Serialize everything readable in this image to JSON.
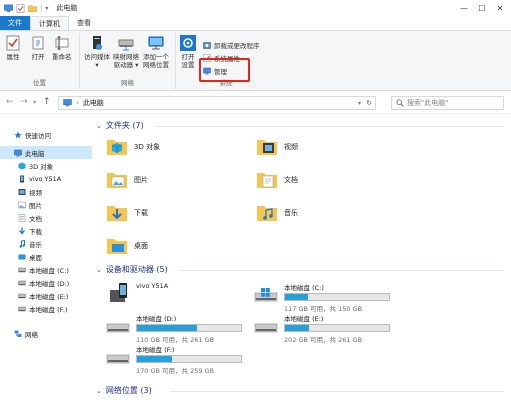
{
  "window": {
    "title": "此电脑",
    "controls": {
      "minimize": "—",
      "maximize": "☐",
      "close": "✕"
    }
  },
  "ribbon_tabs": [
    "文件",
    "计算机",
    "查看"
  ],
  "ribbon": {
    "location_group": {
      "label": "位置",
      "buttons": [
        "属性",
        "打开",
        "重命名"
      ]
    },
    "network_group": {
      "label": "网络",
      "buttons": [
        {
          "line1": "访问媒体",
          "line2": "▾"
        },
        {
          "line1": "映射网络",
          "line2": "驱动器 ▾"
        },
        {
          "line1": "添加一个",
          "line2": "网络位置"
        }
      ]
    },
    "system_group": {
      "label": "系统",
      "open_settings": {
        "line1": "打开",
        "line2": "设置"
      },
      "small_buttons": [
        "卸载或更改程序",
        "系统属性",
        "管理"
      ]
    }
  },
  "address_bar": {
    "breadcrumb": "此电脑",
    "separator": "›",
    "search_placeholder": "搜索\"此电脑\""
  },
  "nav_pane": {
    "items": [
      {
        "label": "快速访问",
        "icon": "star-icon"
      },
      {
        "label": "此电脑",
        "icon": "computer-icon",
        "selected": true
      },
      {
        "label": "3D 对象",
        "icon": "cube-icon"
      },
      {
        "label": "vivo Y51A",
        "icon": "phone-icon"
      },
      {
        "label": "视频",
        "icon": "video-icon"
      },
      {
        "label": "图片",
        "icon": "picture-icon"
      },
      {
        "label": "文档",
        "icon": "document-icon"
      },
      {
        "label": "下载",
        "icon": "download-icon"
      },
      {
        "label": "音乐",
        "icon": "music-icon"
      },
      {
        "label": "桌面",
        "icon": "desktop-icon"
      },
      {
        "label": "本地磁盘 (C:)",
        "icon": "drive-icon"
      },
      {
        "label": "本地磁盘 (D:)",
        "icon": "drive-icon"
      },
      {
        "label": "本地磁盘 (E:)",
        "icon": "drive-icon"
      },
      {
        "label": "本地磁盘 (F:)",
        "icon": "drive-icon"
      },
      {
        "label": "网络",
        "icon": "network-icon"
      }
    ]
  },
  "sections": {
    "folders": {
      "title": "文件夹 (7)",
      "items": [
        {
          "label": "3D 对象",
          "icon": "cube-folder-icon"
        },
        {
          "label": "视频",
          "icon": "video-folder-icon"
        },
        {
          "label": "图片",
          "icon": "picture-folder-icon"
        },
        {
          "label": "文档",
          "icon": "document-folder-icon"
        },
        {
          "label": "下载",
          "icon": "download-folder-icon"
        },
        {
          "label": "音乐",
          "icon": "music-folder-icon"
        },
        {
          "label": "桌面",
          "icon": "desktop-folder-icon"
        }
      ]
    },
    "devices": {
      "title": "设备和驱动器 (5)",
      "phone": {
        "label": "vivo Y51A",
        "icon": "phone-device-icon"
      },
      "drives": [
        {
          "name": "本地磁盘 (C:)",
          "free": "117 GB 可用，共 150 GB",
          "used_fraction": 0.22,
          "system": true
        },
        {
          "name": "本地磁盘 (D:)",
          "free": "110 GB 可用，共 261 GB",
          "used_fraction": 0.58,
          "system": false
        },
        {
          "name": "本地磁盘 (E:)",
          "free": "202 GB 可用，共 261 GB",
          "used_fraction": 0.23,
          "system": false
        },
        {
          "name": "本地磁盘 (F:)",
          "free": "170 GB 可用，共 259 GB",
          "used_fraction": 0.34,
          "system": false
        }
      ]
    },
    "network": {
      "title": "网络位置 (3)"
    }
  },
  "colors": {
    "file_tab": "#1979ca",
    "highlight_box": "#e8231b",
    "drive_bar": "#26a0da",
    "section_title": "#1e3287",
    "selected_nav": "#cce8ff"
  }
}
